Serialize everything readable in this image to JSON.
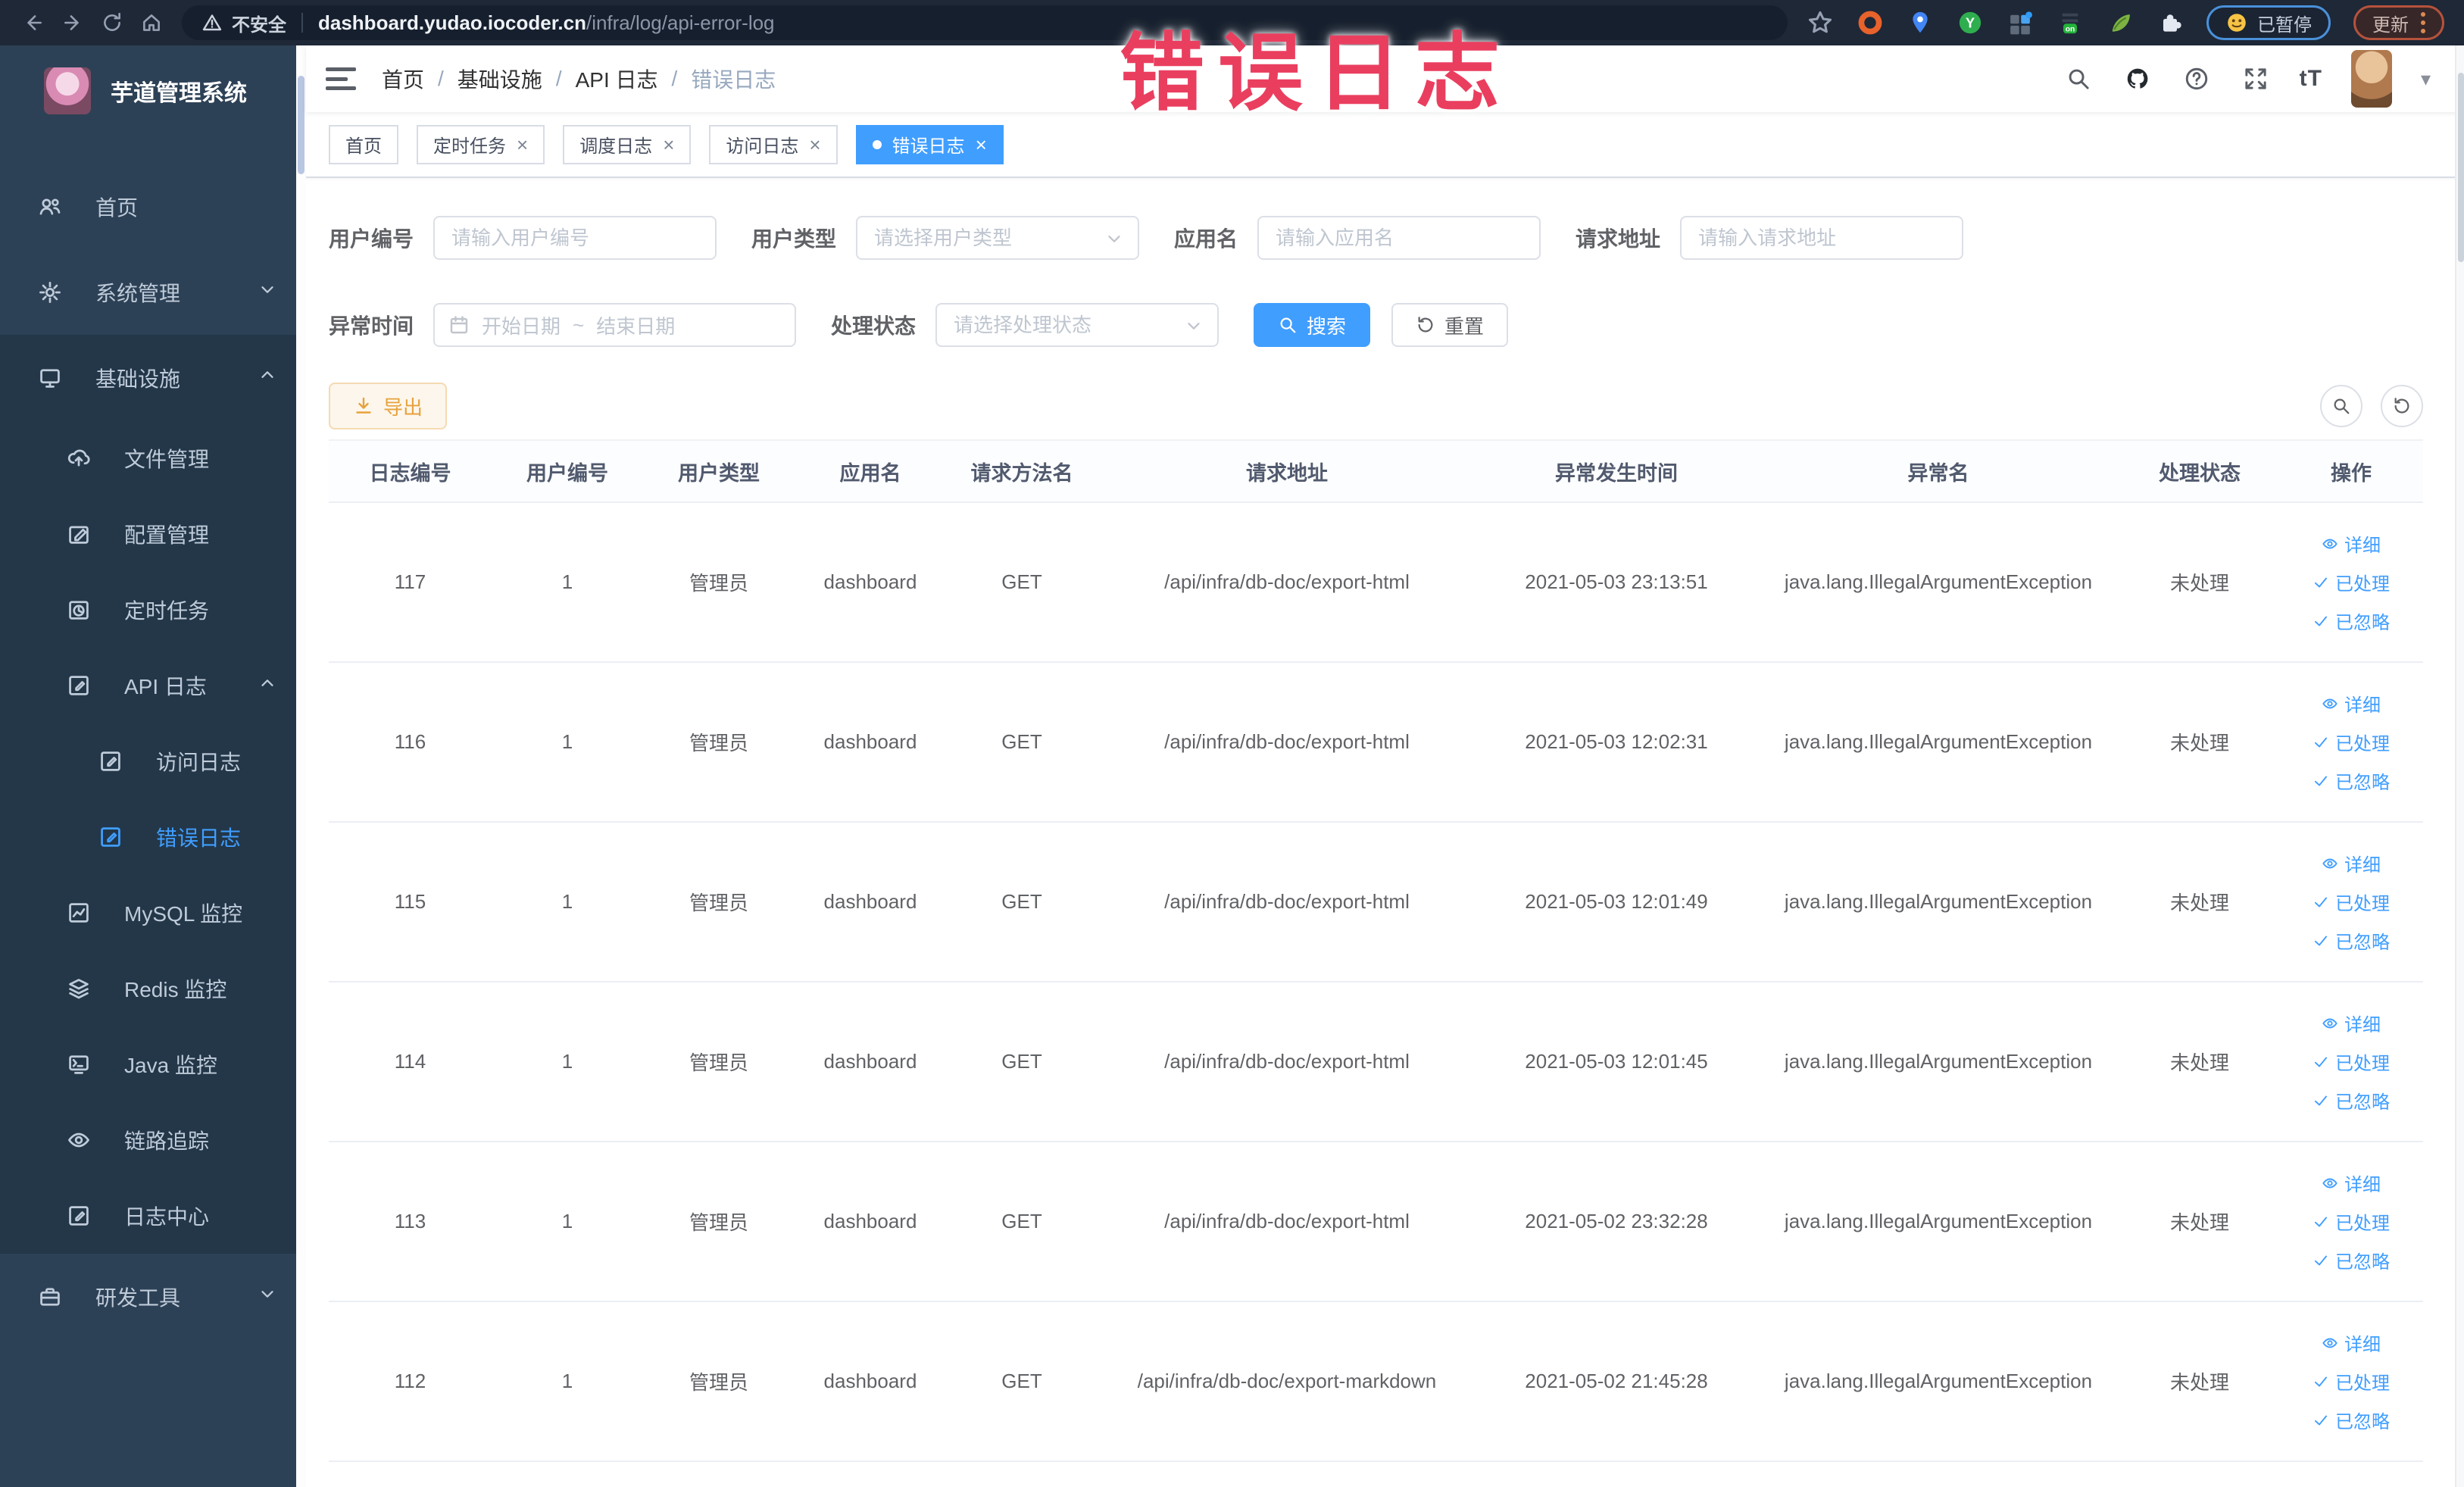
{
  "browser": {
    "security_label": "不安全",
    "url_host": "dashboard.yudao.iocoder.cn",
    "url_path": "/infra/log/api-error-log",
    "paused_label": "已暂停",
    "update_label": "更新",
    "on_badge": "on"
  },
  "watermark": {
    "text": "错误日志"
  },
  "ui": {
    "close_glyph": "×",
    "breadcrumb_separator": "/",
    "caret_glyph": "▾",
    "font_size_icon": "tT"
  },
  "sidebar": {
    "app_title": "芋道管理系统",
    "items": [
      {
        "label": "首页"
      },
      {
        "label": "系统管理"
      },
      {
        "label": "基础设施"
      },
      {
        "label": "文件管理"
      },
      {
        "label": "配置管理"
      },
      {
        "label": "定时任务"
      },
      {
        "label": "API 日志"
      },
      {
        "label": "访问日志"
      },
      {
        "label": "错误日志"
      },
      {
        "label": "MySQL 监控"
      },
      {
        "label": "Redis 监控"
      },
      {
        "label": "Java 监控"
      },
      {
        "label": "链路追踪"
      },
      {
        "label": "日志中心"
      },
      {
        "label": "研发工具"
      }
    ]
  },
  "header": {
    "breadcrumb": [
      "首页",
      "基础设施",
      "API 日志",
      "错误日志"
    ]
  },
  "tabs": [
    {
      "label": "首页"
    },
    {
      "label": "定时任务"
    },
    {
      "label": "调度日志"
    },
    {
      "label": "访问日志"
    },
    {
      "label": "错误日志"
    }
  ],
  "filters": {
    "user_id_label": "用户编号",
    "user_id_placeholder": "请输入用户编号",
    "user_type_label": "用户类型",
    "user_type_placeholder": "请选择用户类型",
    "app_name_label": "应用名",
    "app_name_placeholder": "请输入应用名",
    "request_url_label": "请求地址",
    "request_url_placeholder": "请输入请求地址",
    "error_time_label": "异常时间",
    "start_placeholder": "开始日期",
    "range_separator": "~",
    "end_placeholder": "结束日期",
    "process_status_label": "处理状态",
    "process_status_placeholder": "请选择处理状态",
    "search_label": "搜索",
    "reset_label": "重置"
  },
  "toolbar": {
    "export_label": "导出"
  },
  "table": {
    "columns": [
      "日志编号",
      "用户编号",
      "用户类型",
      "应用名",
      "请求方法名",
      "请求地址",
      "异常发生时间",
      "异常名",
      "处理状态",
      "操作"
    ],
    "actions": [
      "详细",
      "已处理",
      "已忽略"
    ],
    "rows": [
      {
        "log_id": "117",
        "user_id": "1",
        "user_type": "管理员",
        "app_name": "dashboard",
        "method": "GET",
        "url": "/api/infra/db-doc/export-html",
        "time": "2021-05-03 23:13:51",
        "exception": "java.lang.IllegalArgumentException",
        "status": "未处理"
      },
      {
        "log_id": "116",
        "user_id": "1",
        "user_type": "管理员",
        "app_name": "dashboard",
        "method": "GET",
        "url": "/api/infra/db-doc/export-html",
        "time": "2021-05-03 12:02:31",
        "exception": "java.lang.IllegalArgumentException",
        "status": "未处理"
      },
      {
        "log_id": "115",
        "user_id": "1",
        "user_type": "管理员",
        "app_name": "dashboard",
        "method": "GET",
        "url": "/api/infra/db-doc/export-html",
        "time": "2021-05-03 12:01:49",
        "exception": "java.lang.IllegalArgumentException",
        "status": "未处理"
      },
      {
        "log_id": "114",
        "user_id": "1",
        "user_type": "管理员",
        "app_name": "dashboard",
        "method": "GET",
        "url": "/api/infra/db-doc/export-html",
        "time": "2021-05-03 12:01:45",
        "exception": "java.lang.IllegalArgumentException",
        "status": "未处理"
      },
      {
        "log_id": "113",
        "user_id": "1",
        "user_type": "管理员",
        "app_name": "dashboard",
        "method": "GET",
        "url": "/api/infra/db-doc/export-html",
        "time": "2021-05-02 23:32:28",
        "exception": "java.lang.IllegalArgumentException",
        "status": "未处理"
      },
      {
        "log_id": "112",
        "user_id": "1",
        "user_type": "管理员",
        "app_name": "dashboard",
        "method": "GET",
        "url": "/api/infra/db-doc/export-markdown",
        "time": "2021-05-02 21:45:28",
        "exception": "java.lang.IllegalArgumentException",
        "status": "未处理"
      }
    ]
  },
  "colors": {
    "accent": "#409eff",
    "warning": "#e6a23c",
    "watermark": "#ea3e5f",
    "sidebar_bg": "#2d4156",
    "sidebar_sub_bg": "#233749",
    "browser_bar_bg": "#1e2837"
  }
}
